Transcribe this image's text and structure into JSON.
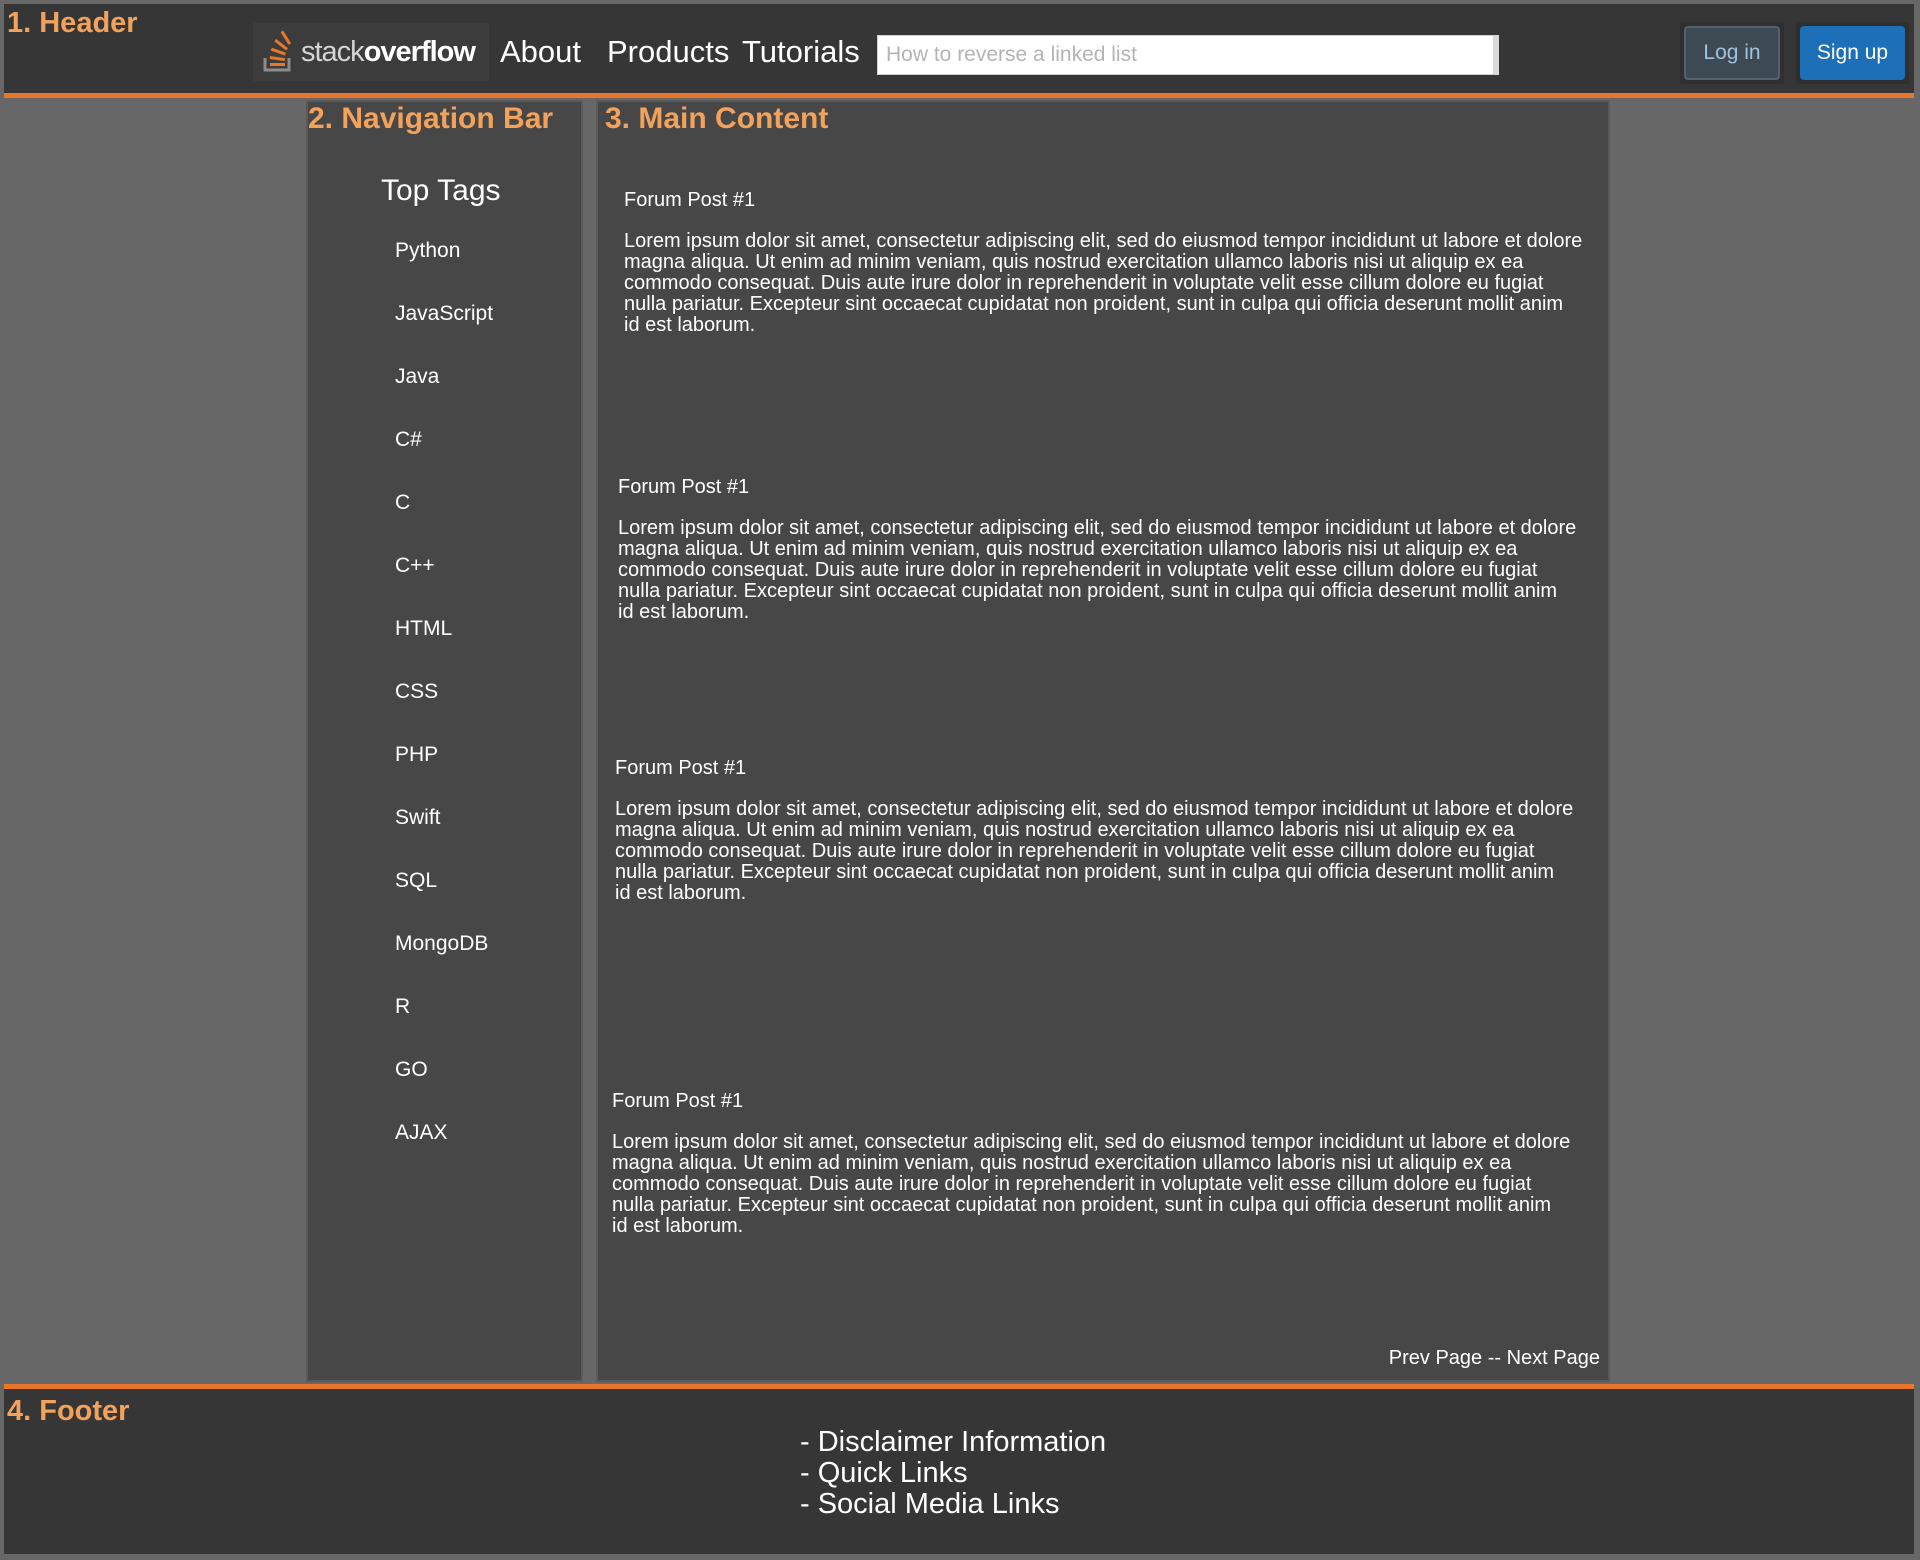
{
  "header": {
    "section_label": "1. Header",
    "logo": {
      "text_light": "stack",
      "text_bold": "overflow"
    },
    "nav": {
      "about": "About",
      "products": "Products",
      "tutorials": "Tutorials"
    },
    "search": {
      "placeholder": "How to reverse a linked list",
      "value": ""
    },
    "login_label": "Log in",
    "signup_label": "Sign up"
  },
  "navbar": {
    "section_label": "2. Navigation Bar",
    "title": "Top Tags",
    "tags": [
      "Python",
      "JavaScript",
      "Java",
      "C#",
      "C",
      "C++",
      "HTML",
      "CSS",
      "PHP",
      "Swift",
      "SQL",
      "MongoDB",
      "R",
      "GO",
      "AJAX"
    ]
  },
  "main": {
    "section_label": "3. Main Content",
    "posts": [
      {
        "title": "Forum Post #1",
        "body": "Lorem ipsum dolor sit amet, consectetur adipiscing elit, sed do eiusmod tempor incididunt ut labore et dolore magna aliqua. Ut enim ad minim veniam, quis nostrud exercitation ullamco laboris nisi ut aliquip ex ea commodo consequat. Duis aute irure dolor in reprehenderit in voluptate velit esse cillum dolore eu fugiat nulla pariatur. Excepteur sint occaecat cupidatat non proident, sunt in culpa qui officia deserunt mollit anim id est laborum."
      },
      {
        "title": "Forum Post #1",
        "body": "Lorem ipsum dolor sit amet, consectetur adipiscing elit, sed do eiusmod tempor incididunt ut labore et dolore magna aliqua. Ut enim ad minim veniam, quis nostrud exercitation ullamco laboris nisi ut aliquip ex ea commodo consequat. Duis aute irure dolor in reprehenderit in voluptate velit esse cillum dolore eu fugiat nulla pariatur. Excepteur sint occaecat cupidatat non proident, sunt in culpa qui officia deserunt mollit anim id est laborum."
      },
      {
        "title": "Forum Post #1",
        "body": "Lorem ipsum dolor sit amet, consectetur adipiscing elit, sed do eiusmod tempor incididunt ut labore et dolore magna aliqua. Ut enim ad minim veniam, quis nostrud exercitation ullamco laboris nisi ut aliquip ex ea commodo consequat. Duis aute irure dolor in reprehenderit in voluptate velit esse cillum dolore eu fugiat nulla pariatur. Excepteur sint occaecat cupidatat non proident, sunt in culpa qui officia deserunt mollit anim id est laborum."
      },
      {
        "title": "Forum Post #1",
        "body": "Lorem ipsum dolor sit amet, consectetur adipiscing elit, sed do eiusmod tempor incididunt ut labore et dolore magna aliqua. Ut enim ad minim veniam, quis nostrud exercitation ullamco laboris nisi ut aliquip ex ea commodo consequat. Duis aute irure dolor in reprehenderit in voluptate velit esse cillum dolore eu fugiat nulla pariatur. Excepteur sint occaecat cupidatat non proident, sunt in culpa qui officia deserunt mollit anim id est laborum."
      }
    ],
    "pager": {
      "prev": "Prev Page",
      "separator": " -- ",
      "next": "Next Page"
    }
  },
  "footer": {
    "section_label": "4. Footer",
    "links": [
      "- Disclaimer Information",
      "- Quick Links",
      "- Social Media Links"
    ]
  },
  "colors": {
    "accent": "#e8762b",
    "section_label": "#f3a25c",
    "signup_button": "#1d6fb7",
    "background": "#676767",
    "panel": "#474747",
    "bar": "#363636"
  }
}
